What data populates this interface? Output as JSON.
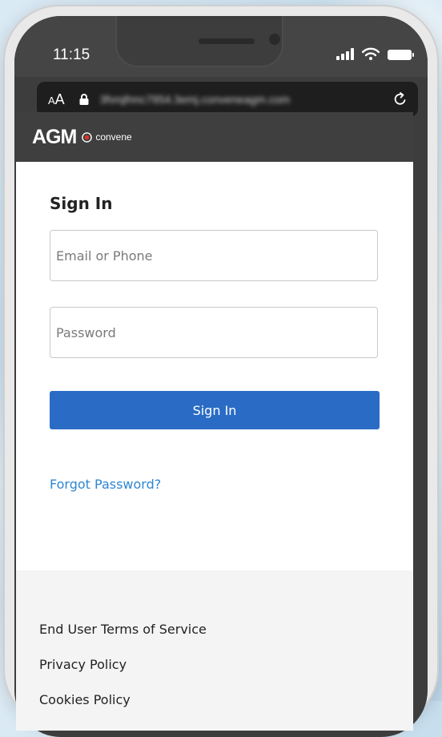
{
  "status_bar": {
    "time": "11:15",
    "icons": [
      "signal-icon",
      "wifi-icon",
      "battery-icon"
    ]
  },
  "browser": {
    "text_size_label": "AA",
    "url": "3fvrqfnnc7954.3emj.conveneagm.com",
    "icons": [
      "lock-icon",
      "reload-icon"
    ]
  },
  "header": {
    "logo_text": "AGM",
    "brand_text": "convene",
    "brand_color": "#e0312b"
  },
  "form": {
    "title": "Sign In",
    "email_placeholder": "Email or Phone",
    "email_value": "",
    "password_placeholder": "Password",
    "password_value": "",
    "submit_label": "Sign In",
    "forgot_label": "Forgot Password?"
  },
  "footer": {
    "links": [
      "End User Terms of Service",
      "Privacy Policy",
      "Cookies Policy"
    ]
  },
  "colors": {
    "primary_button": "#2a6cc5",
    "link": "#2d86d4",
    "header_bg": "#3f3f3f"
  }
}
